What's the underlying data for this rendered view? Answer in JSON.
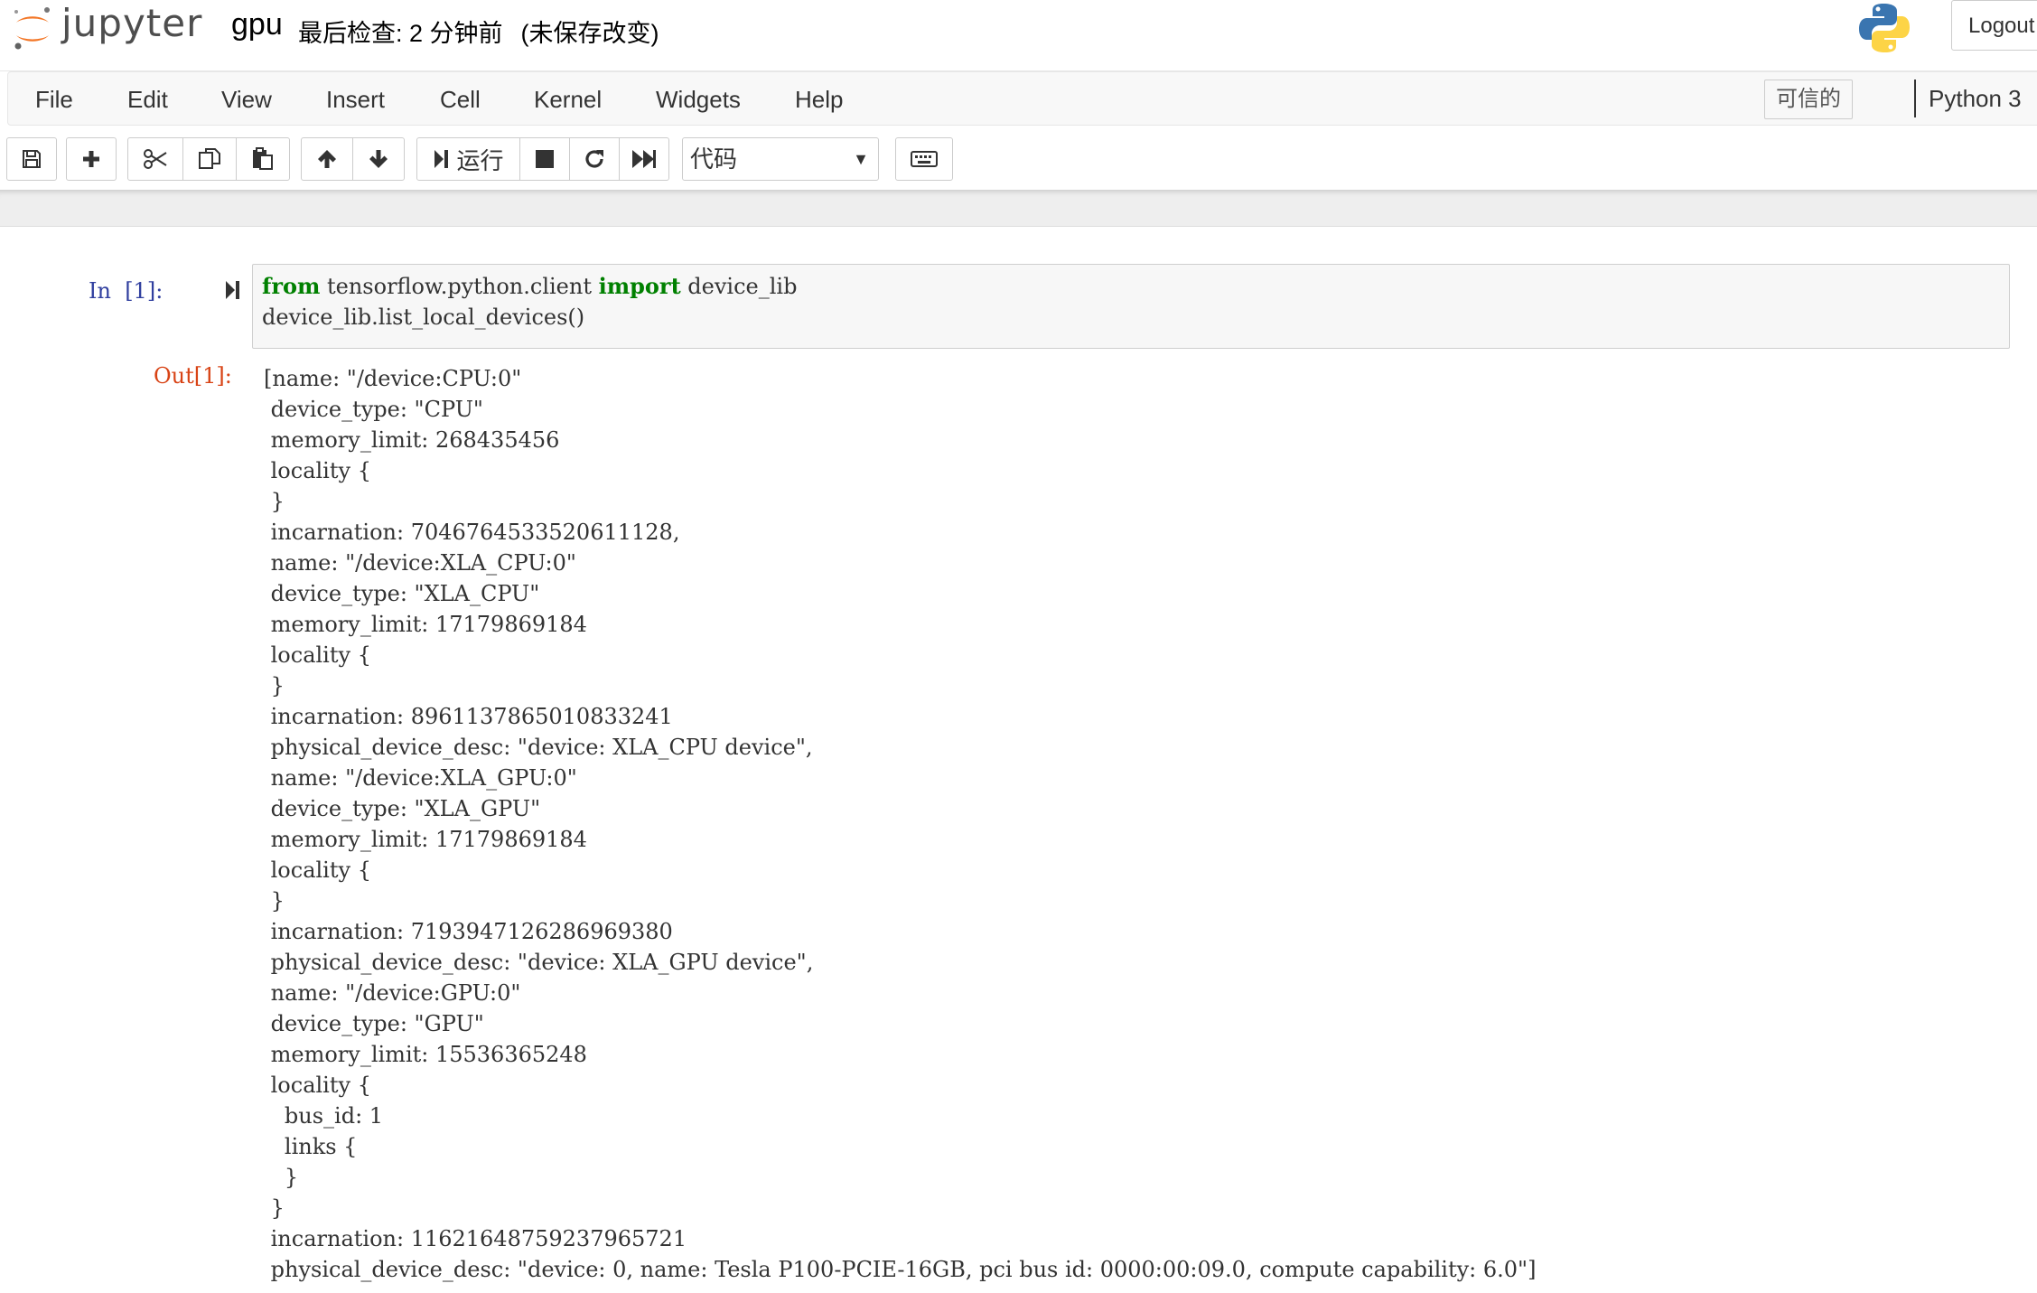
{
  "header": {
    "logo_text": "jupyter",
    "notebook_name": "gpu",
    "checkpoint_text": "最后检查: 2 分钟前",
    "unsaved_text": "(未保存改变)",
    "logout_label": "Logout"
  },
  "menubar": {
    "items": [
      "File",
      "Edit",
      "View",
      "Insert",
      "Cell",
      "Kernel",
      "Widgets",
      "Help"
    ],
    "trusted_label": "可信的",
    "kernel_name": "Python 3"
  },
  "toolbar": {
    "run_label": "运行",
    "cell_type": "代码",
    "icons": [
      "save-icon",
      "plus-icon",
      "cut-icon",
      "copy-icon",
      "paste-icon",
      "arrow-up-icon",
      "arrow-down-icon",
      "run-icon",
      "stop-icon",
      "restart-icon",
      "fast-forward-icon",
      "keyboard-icon"
    ]
  },
  "cell": {
    "in_prompt": "In  [1]:",
    "code_line1_kw1": "from",
    "code_line1_mid": " tensorflow.python.client ",
    "code_line1_kw2": "import",
    "code_line1_end": " device_lib",
    "code_line2": "device_lib.list_local_devices()",
    "out_prompt": "Out[1]:",
    "output_lines": [
      "[name: \"/device:CPU:0\"",
      " device_type: \"CPU\"",
      " memory_limit: 268435456",
      " locality {",
      " }",
      " incarnation: 7046764533520611128,",
      " name: \"/device:XLA_CPU:0\"",
      " device_type: \"XLA_CPU\"",
      " memory_limit: 17179869184",
      " locality {",
      " }",
      " incarnation: 8961137865010833241",
      " physical_device_desc: \"device: XLA_CPU device\",",
      " name: \"/device:XLA_GPU:0\"",
      " device_type: \"XLA_GPU\"",
      " memory_limit: 17179869184",
      " locality {",
      " }",
      " incarnation: 7193947126286969380",
      " physical_device_desc: \"device: XLA_GPU device\",",
      " name: \"/device:GPU:0\"",
      " device_type: \"GPU\"",
      " memory_limit: 15536365248",
      " locality {",
      "   bus_id: 1",
      "   links {",
      "   }",
      " }",
      " incarnation: 11621648759237965721",
      " physical_device_desc: \"device: 0, name: Tesla P100-PCIE-16GB, pci bus id: 0000:00:09.0, compute capability: 6.0\"]"
    ]
  }
}
